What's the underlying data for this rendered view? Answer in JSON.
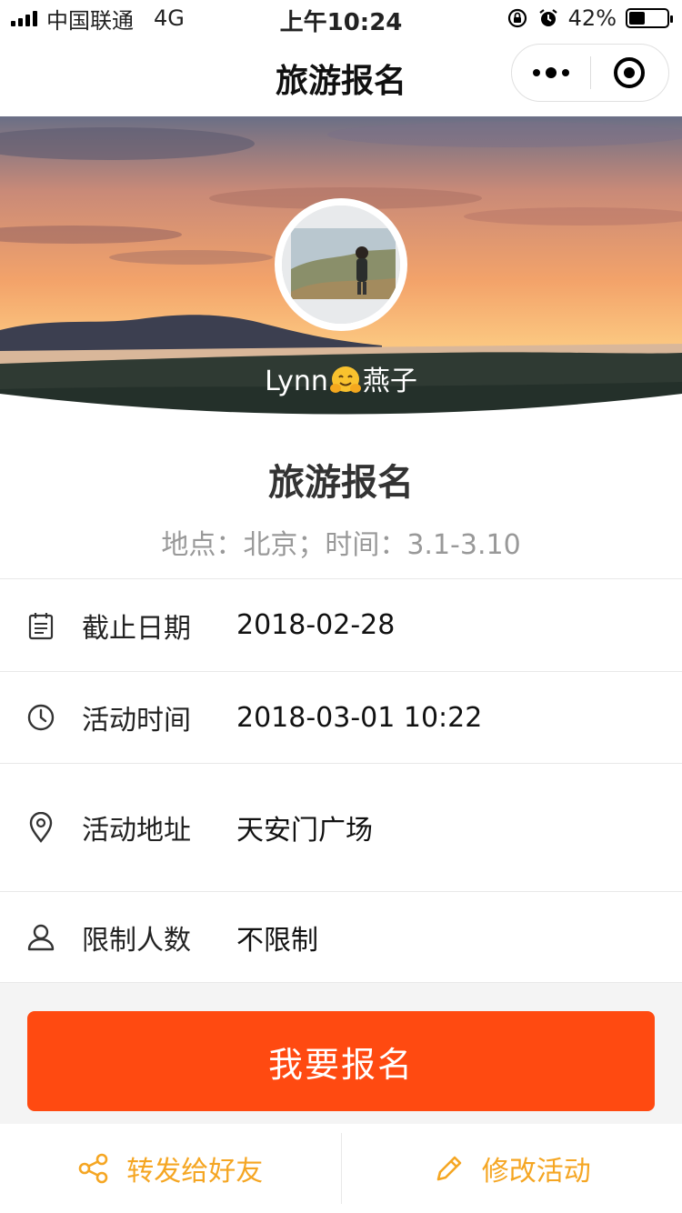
{
  "status_bar": {
    "carrier": "中国联通",
    "network": "4G",
    "time": "上午10:24",
    "battery": "42%",
    "battery_level": 0.42
  },
  "nav": {
    "title": "旅游报名"
  },
  "hero": {
    "user_name": "Lynn",
    "user_name_suffix": "燕子"
  },
  "event": {
    "title": "旅游报名",
    "subtitle": "地点：北京；时间：3.1-3.10"
  },
  "details": [
    {
      "icon": "calendar-icon",
      "label": "截止日期",
      "value": "2018-02-28"
    },
    {
      "icon": "clock-icon",
      "label": "活动时间",
      "value": "2018-03-01 10:22"
    },
    {
      "icon": "location-icon",
      "label": "活动地址",
      "value": "天安门广场"
    },
    {
      "icon": "person-icon",
      "label": "限制人数",
      "value": "不限制"
    }
  ],
  "actions": {
    "signup": "我要报名",
    "share": "转发给好友",
    "edit": "修改活动"
  },
  "colors": {
    "primary": "#ff4a11",
    "accent": "#f5a623"
  }
}
